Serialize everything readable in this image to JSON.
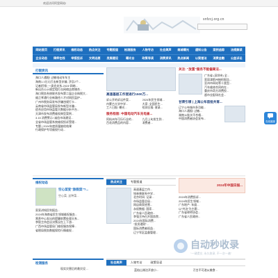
{
  "topbar": {
    "welcome": "欢迎访问阿里网站!"
  },
  "header": {
    "domain": "snfzcj.org.cn"
  },
  "nav": {
    "row1": [
      "网站首页",
      "打假资讯",
      "维权动态",
      "热点关注",
      "专题报道",
      "检测服务",
      "人物专访",
      "社会舆声",
      "商城曝光",
      "通知公告",
      "案例追踪",
      "法规解读"
    ],
    "row2": [
      "企业动态",
      "律师在线",
      "举报投诉",
      "文明志愿",
      "发展建设",
      "曝光台",
      "政策导读",
      "消费资讯",
      "热点新闻",
      "以案普法",
      "消费金融",
      "公益诉讼"
    ]
  },
  "left": {
    "title": "打假资讯",
    "items": [
      "海口人通报! 过敏电动车车主",
      "海南1.1亿元打击新型诈骗, 涉及2个...",
      "记者招领! 一类会关系-2024“网络...",
      "新出台公示规定相打击网络店商铺合...",
      "海口税务系统联合发布第二届企业纳税大...",
      "维正孝通行业新路径人才对网民监护...",
      "广州市税务局发布涉嫌违规打卡...",
      "云南省市场监管局发布新型诈骗...",
      "综合应用市场监管大数据分析平台...",
      "天津市发布消费维权典型案例...",
      "3.15 消费警示! 诚信市场建设...",
      "全省市场监管系统维权投诉受理...",
      "专题 | 2024年度质量抽检结果",
      "行政保护专项维权行动..."
    ]
  },
  "mid": {
    "headline": "高速基层工作室进行1500万...",
    "grid": [
      "诉公开的诉讼件案...",
      "2024年民生领域...",
      "内蒙古大学中学...",
      "大家: 全国民生...",
      "工人日报: 曝光...",
      "检测日报: 收录..."
    ],
    "sub_headline": "服务检验: 中国电动汽车充电查...",
    "items": [
      "阿杭州车可乐行业的...",
      "九月上旬发生到...",
      "百花消费品的内容...",
      "消费者..."
    ]
  },
  "right": {
    "headline": "关注: “放置”服务不能偏离法...",
    "items": [
      "广东省 (深圳市) 全...",
      "家居津斯州抽检报告...",
      "亚州市网站等十类型...",
      "汽车维修合同的在...",
      "重庆市奇方消费投...",
      "超市业配场社会..."
    ],
    "bottom_headline": "甘肃引领 | 上海公布首批共育...",
    "bottom_items": [
      "辽宁公布城市多功能...",
      "海口人通报! 过敏...",
      "湖南11批次不合格...",
      "中国消费者协会发布..."
    ]
  },
  "float_button": {
    "label": "在线客服"
  },
  "bottom_left": {
    "title": "维权动态",
    "feature_title": "空心菜变“旅假菜”?...",
    "feature_text": "空心菜, 这种菜...",
    "items": [
      "家家讲知民利报告...",
      "2024年海南省民生领域维权服务...",
      "营养中心发出的提醒前置处理天系...",
      "李毅主持会议决策议在上下游...",
      "广西市场监管局门维权服务保障...",
      "省税局税务数据保险行情维权..."
    ]
  },
  "bottom_mid": {
    "tabs": [
      "热点关注",
      "专题报道"
    ],
    "items": [
      "高速基层工作...",
      "钱林曾联系中学...",
      "北京时间: 记录...",
      "市场监管总局...",
      "网店商家经营...",
      "永权数据: 国家...",
      "广东省人民政府...",
      "李强主持召开国务院...",
      "2024年国际消费...",
      "“投资理财”...",
      "国际消费者权益...",
      "辽宁军区监督管理..."
    ]
  },
  "bottom_right": {
    "banner": "2024年中国日报...",
    "items": [
      "2024年消费投诉...",
      "2024年民生领域...",
      "广东地产: 年度...",
      "以“共治”为主题...",
      "广东省律师协会...",
      "广东省人民政府..."
    ]
  },
  "bottom_row": {
    "left_title": "检测服务",
    "left_item": "现实灾害后的救灾设 ...",
    "tabs": [
      "社会舆声",
      "人物专访",
      "政策导读"
    ],
    "mid_item": "蓝焰山湖泊开放小...",
    "right_item": "污言不可遂从美食..."
  },
  "watermark": {
    "title": "自动秒收录",
    "subtitle": "“一键提交, 永久收录, 不一次一遍”"
  }
}
